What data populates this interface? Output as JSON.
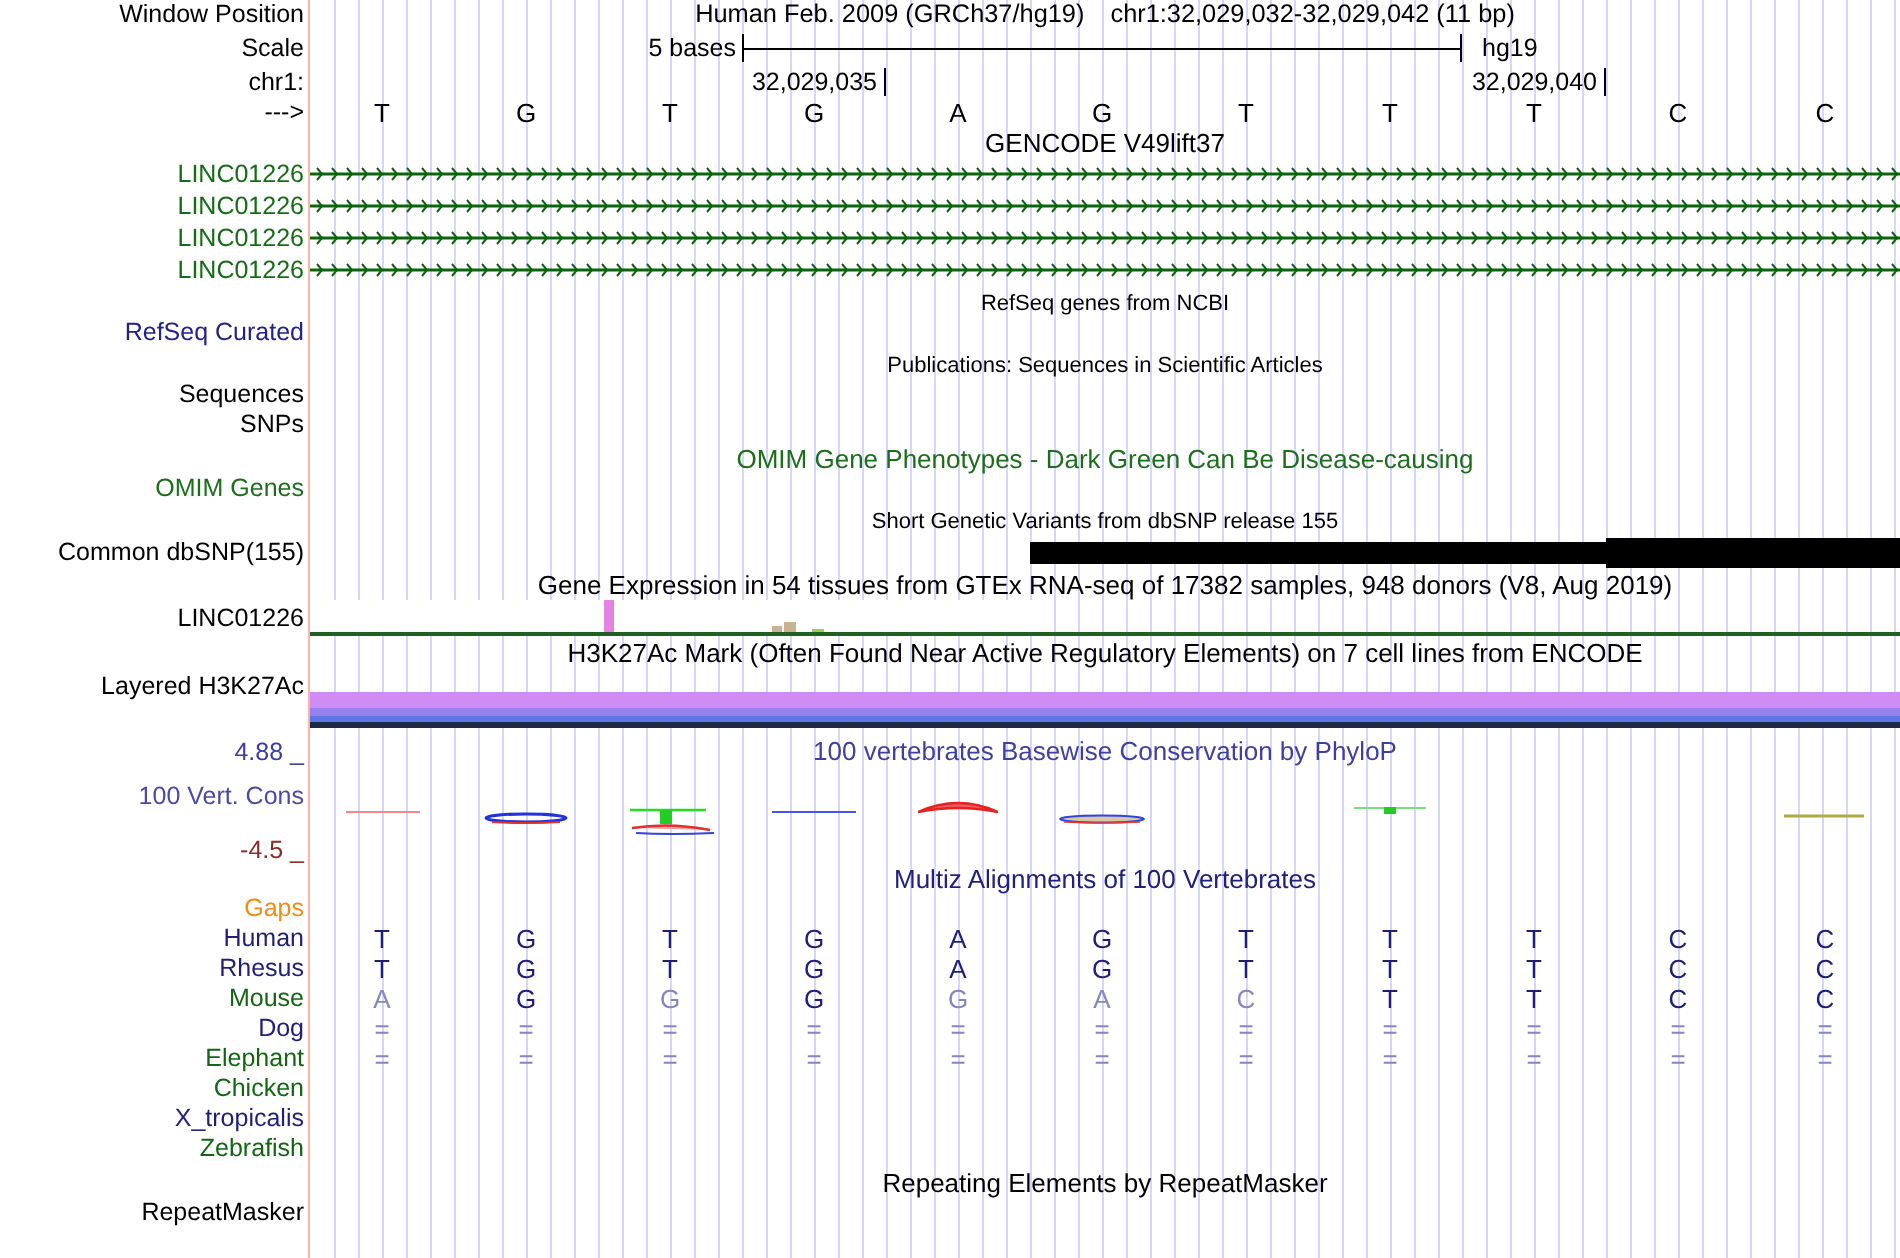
{
  "header": {
    "label": "Window Position",
    "assembly": "Human Feb. 2009 (GRCh37/hg19)",
    "position": "chr1:32,029,032-32,029,042 (11 bp)"
  },
  "scale": {
    "label": "Scale",
    "length": "5 bases",
    "assembly": "hg19"
  },
  "coordinates": {
    "label": "chr1:",
    "ticks": [
      "32,029,035",
      "32,029,040"
    ]
  },
  "sequence": {
    "label": "--->",
    "bases": [
      "T",
      "G",
      "T",
      "G",
      "A",
      "G",
      "T",
      "T",
      "T",
      "C",
      "C"
    ]
  },
  "tracks": [
    {
      "kind": "transcripts",
      "supertrack": false,
      "title": {
        "text": "GENCODE V49lift37",
        "color": "#000000"
      },
      "rows": [
        {
          "label": "LINC01226",
          "color": "#146c14",
          "forward": true
        },
        {
          "label": "LINC01226",
          "color": "#146c14",
          "forward": true
        },
        {
          "label": "LINC01226",
          "color": "#146c14",
          "forward": true
        },
        {
          "label": "LINC01226",
          "color": "#146c14",
          "forward": true
        }
      ]
    },
    {
      "kind": "labels",
      "supertrack": true,
      "title": {
        "text": "RefSeq genes from NCBI",
        "color": "#000000"
      },
      "rows": [
        {
          "label": "RefSeq Curated",
          "color": "#22228c"
        }
      ]
    },
    {
      "kind": "labels",
      "supertrack": true,
      "title": {
        "text": "Publications: Sequences in Scientific Articles",
        "color": "#000000"
      },
      "rows": [
        {
          "label": "Sequences",
          "color": "#000000"
        },
        {
          "label": "SNPs",
          "color": "#000000"
        }
      ]
    },
    {
      "kind": "labels",
      "supertrack": false,
      "title": {
        "text": "OMIM Gene Phenotypes - Dark Green Can Be Disease-causing",
        "color": "#1c6e1c"
      },
      "rows": [
        {
          "label": "OMIM Genes",
          "color": "#1c6e1c"
        }
      ]
    },
    {
      "kind": "variants",
      "supertrack": true,
      "title": {
        "text": "Short Genetic Variants from dbSNP release 155",
        "color": "#000000"
      },
      "rows": [
        {
          "label": "Common dbSNP(155)",
          "color": "#000000"
        }
      ]
    },
    {
      "kind": "expression",
      "supertrack": false,
      "title": {
        "text": "Gene Expression in 54 tissues from GTEx RNA-seq of 17382 samples, 948 donors (V8, Aug 2019)",
        "color": "#000000"
      },
      "rows": [
        {
          "label": "LINC01226",
          "color": "#000000"
        }
      ]
    },
    {
      "kind": "layered_signal",
      "supertrack": false,
      "title": {
        "text": "H3K27Ac Mark (Often Found Near Active Regulatory Elements) on 7 cell lines from ENCODE",
        "color": "#000000"
      },
      "rows": [
        {
          "label": "Layered H3K27Ac",
          "color": "#000000"
        }
      ]
    },
    {
      "kind": "conservation",
      "supertrack": false,
      "title": {
        "text": "100 vertebrates Basewise Conservation by PhyloP",
        "color": "#3f3f9f"
      },
      "axis_max": "4.88 _",
      "axis_min": "-4.5 _",
      "rows": [
        {
          "label": "100 Vert. Cons",
          "color": "#4a4aa6"
        }
      ]
    },
    {
      "kind": "alignment",
      "supertrack": false,
      "title": {
        "text": "Multiz Alignments of 100 Vertebrates",
        "color": "#20207e"
      },
      "rows": [
        {
          "label": "Gaps",
          "color": "#ee8c14"
        },
        {
          "label": "Human",
          "color": "#1f1f7a",
          "bases": [
            {
              "text": "T",
              "dimmed": false
            },
            {
              "text": "G",
              "dimmed": false
            },
            {
              "text": "T",
              "dimmed": false
            },
            {
              "text": "G",
              "dimmed": false
            },
            {
              "text": "A",
              "dimmed": false
            },
            {
              "text": "G",
              "dimmed": false
            },
            {
              "text": "T",
              "dimmed": false
            },
            {
              "text": "T",
              "dimmed": false
            },
            {
              "text": "T",
              "dimmed": false
            },
            {
              "text": "C",
              "dimmed": false
            },
            {
              "text": "C",
              "dimmed": false
            }
          ]
        },
        {
          "label": "Rhesus",
          "color": "#1f1f7a",
          "bases": [
            {
              "text": "T",
              "dimmed": false
            },
            {
              "text": "G",
              "dimmed": false
            },
            {
              "text": "T",
              "dimmed": false
            },
            {
              "text": "G",
              "dimmed": false
            },
            {
              "text": "A",
              "dimmed": false
            },
            {
              "text": "G",
              "dimmed": false
            },
            {
              "text": "T",
              "dimmed": false
            },
            {
              "text": "T",
              "dimmed": false
            },
            {
              "text": "T",
              "dimmed": false
            },
            {
              "text": "C",
              "dimmed": false
            },
            {
              "text": "C",
              "dimmed": false
            }
          ]
        },
        {
          "label": "Mouse",
          "color": "#126612",
          "bases": [
            {
              "text": "A",
              "dimmed": true
            },
            {
              "text": "G",
              "dimmed": false
            },
            {
              "text": "G",
              "dimmed": true
            },
            {
              "text": "G",
              "dimmed": false
            },
            {
              "text": "G",
              "dimmed": true
            },
            {
              "text": "A",
              "dimmed": true
            },
            {
              "text": "C",
              "dimmed": true
            },
            {
              "text": "T",
              "dimmed": false
            },
            {
              "text": "T",
              "dimmed": false
            },
            {
              "text": "C",
              "dimmed": false
            },
            {
              "text": "C",
              "dimmed": false
            }
          ]
        },
        {
          "label": "Dog",
          "color": "#1f1f7a",
          "bases": [
            {
              "text": "=",
              "dimmed": true
            },
            {
              "text": "=",
              "dimmed": true
            },
            {
              "text": "=",
              "dimmed": true
            },
            {
              "text": "=",
              "dimmed": true
            },
            {
              "text": "=",
              "dimmed": true
            },
            {
              "text": "=",
              "dimmed": true
            },
            {
              "text": "=",
              "dimmed": true
            },
            {
              "text": "=",
              "dimmed": true
            },
            {
              "text": "=",
              "dimmed": true
            },
            {
              "text": "=",
              "dimmed": true
            },
            {
              "text": "=",
              "dimmed": true
            }
          ]
        },
        {
          "label": "Elephant",
          "color": "#126612",
          "bases": [
            {
              "text": "=",
              "dimmed": true
            },
            {
              "text": "=",
              "dimmed": true
            },
            {
              "text": "=",
              "dimmed": true
            },
            {
              "text": "=",
              "dimmed": true
            },
            {
              "text": "=",
              "dimmed": true
            },
            {
              "text": "=",
              "dimmed": true
            },
            {
              "text": "=",
              "dimmed": true
            },
            {
              "text": "=",
              "dimmed": true
            },
            {
              "text": "=",
              "dimmed": true
            },
            {
              "text": "=",
              "dimmed": true
            },
            {
              "text": "=",
              "dimmed": true
            }
          ]
        },
        {
          "label": "Chicken",
          "color": "#126612"
        },
        {
          "label": "X_tropicalis",
          "color": "#1f1f7a"
        },
        {
          "label": "Zebrafish",
          "color": "#126612"
        }
      ]
    },
    {
      "kind": "labels",
      "supertrack": false,
      "title": {
        "text": "Repeating Elements by RepeatMasker",
        "color": "#000000"
      },
      "rows": [
        {
          "label": "RepeatMasker",
          "color": "#000000"
        }
      ]
    }
  ]
}
